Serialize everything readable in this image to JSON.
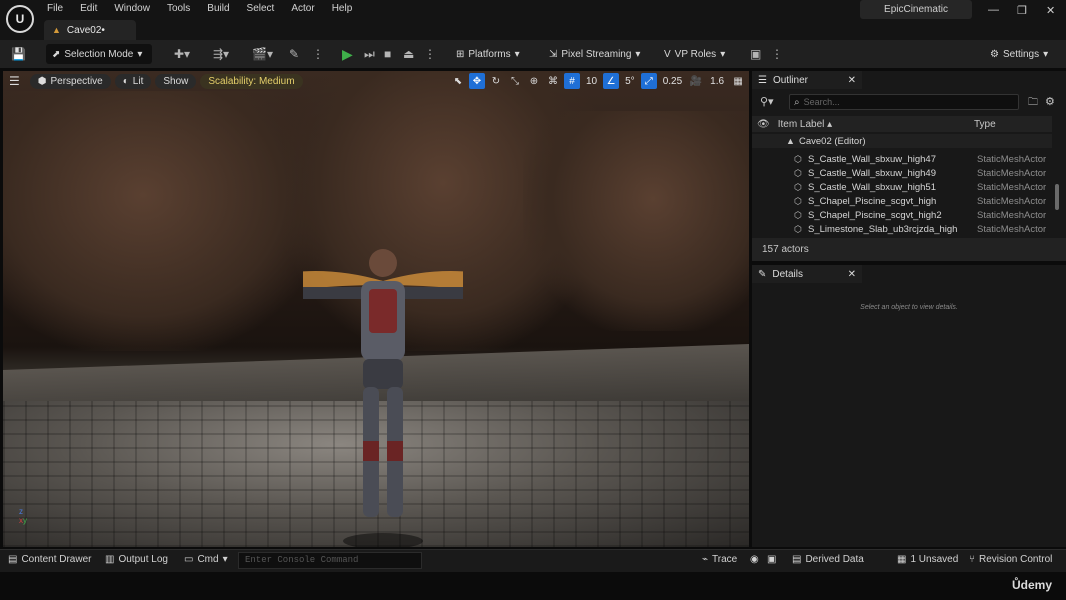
{
  "app": {
    "menu": [
      "File",
      "Edit",
      "Window",
      "Tools",
      "Build",
      "Select",
      "Actor",
      "Help"
    ],
    "doc_tab": "Cave02•",
    "project": "EpicCinematic",
    "win_min": "—",
    "win_restore": "❐",
    "win_close": "✕"
  },
  "toolbar": {
    "selection_mode": "Selection Mode",
    "platforms": "Platforms",
    "pixel_streaming": "Pixel Streaming",
    "vp_roles": "VP Roles",
    "settings": "Settings"
  },
  "viewport": {
    "perspective": "Perspective",
    "lit": "Lit",
    "show": "Show",
    "scalability": "Scalability: Medium",
    "grid": "10",
    "angle": "5°",
    "scale": "0.25",
    "cam_speed": "1.6"
  },
  "outliner": {
    "title": "Outliner",
    "search_placeholder": "Search...",
    "col_label": "Item Label ▴",
    "col_type": "Type",
    "root": "Cave02 (Editor)",
    "rows": [
      {
        "name": "S_Castle_Wall_sbxuw_high47",
        "type": "StaticMeshActor"
      },
      {
        "name": "S_Castle_Wall_sbxuw_high49",
        "type": "StaticMeshActor"
      },
      {
        "name": "S_Castle_Wall_sbxuw_high51",
        "type": "StaticMeshActor"
      },
      {
        "name": "S_Chapel_Piscine_scgvt_high",
        "type": "StaticMeshActor"
      },
      {
        "name": "S_Chapel_Piscine_scgvt_high2",
        "type": "StaticMeshActor"
      },
      {
        "name": "S_Limestone_Slab_ub3rcjzda_high",
        "type": "StaticMeshActor"
      }
    ],
    "count": "157 actors"
  },
  "details": {
    "title": "Details",
    "empty": "Select an object to view details."
  },
  "status": {
    "content_drawer": "Content Drawer",
    "output_log": "Output Log",
    "cmd": "Cmd",
    "console_placeholder": "Enter Console Command",
    "trace": "Trace",
    "derived": "Derived Data",
    "unsaved": "1 Unsaved",
    "revision": "Revision Control"
  },
  "watermark": "Ůdemy"
}
